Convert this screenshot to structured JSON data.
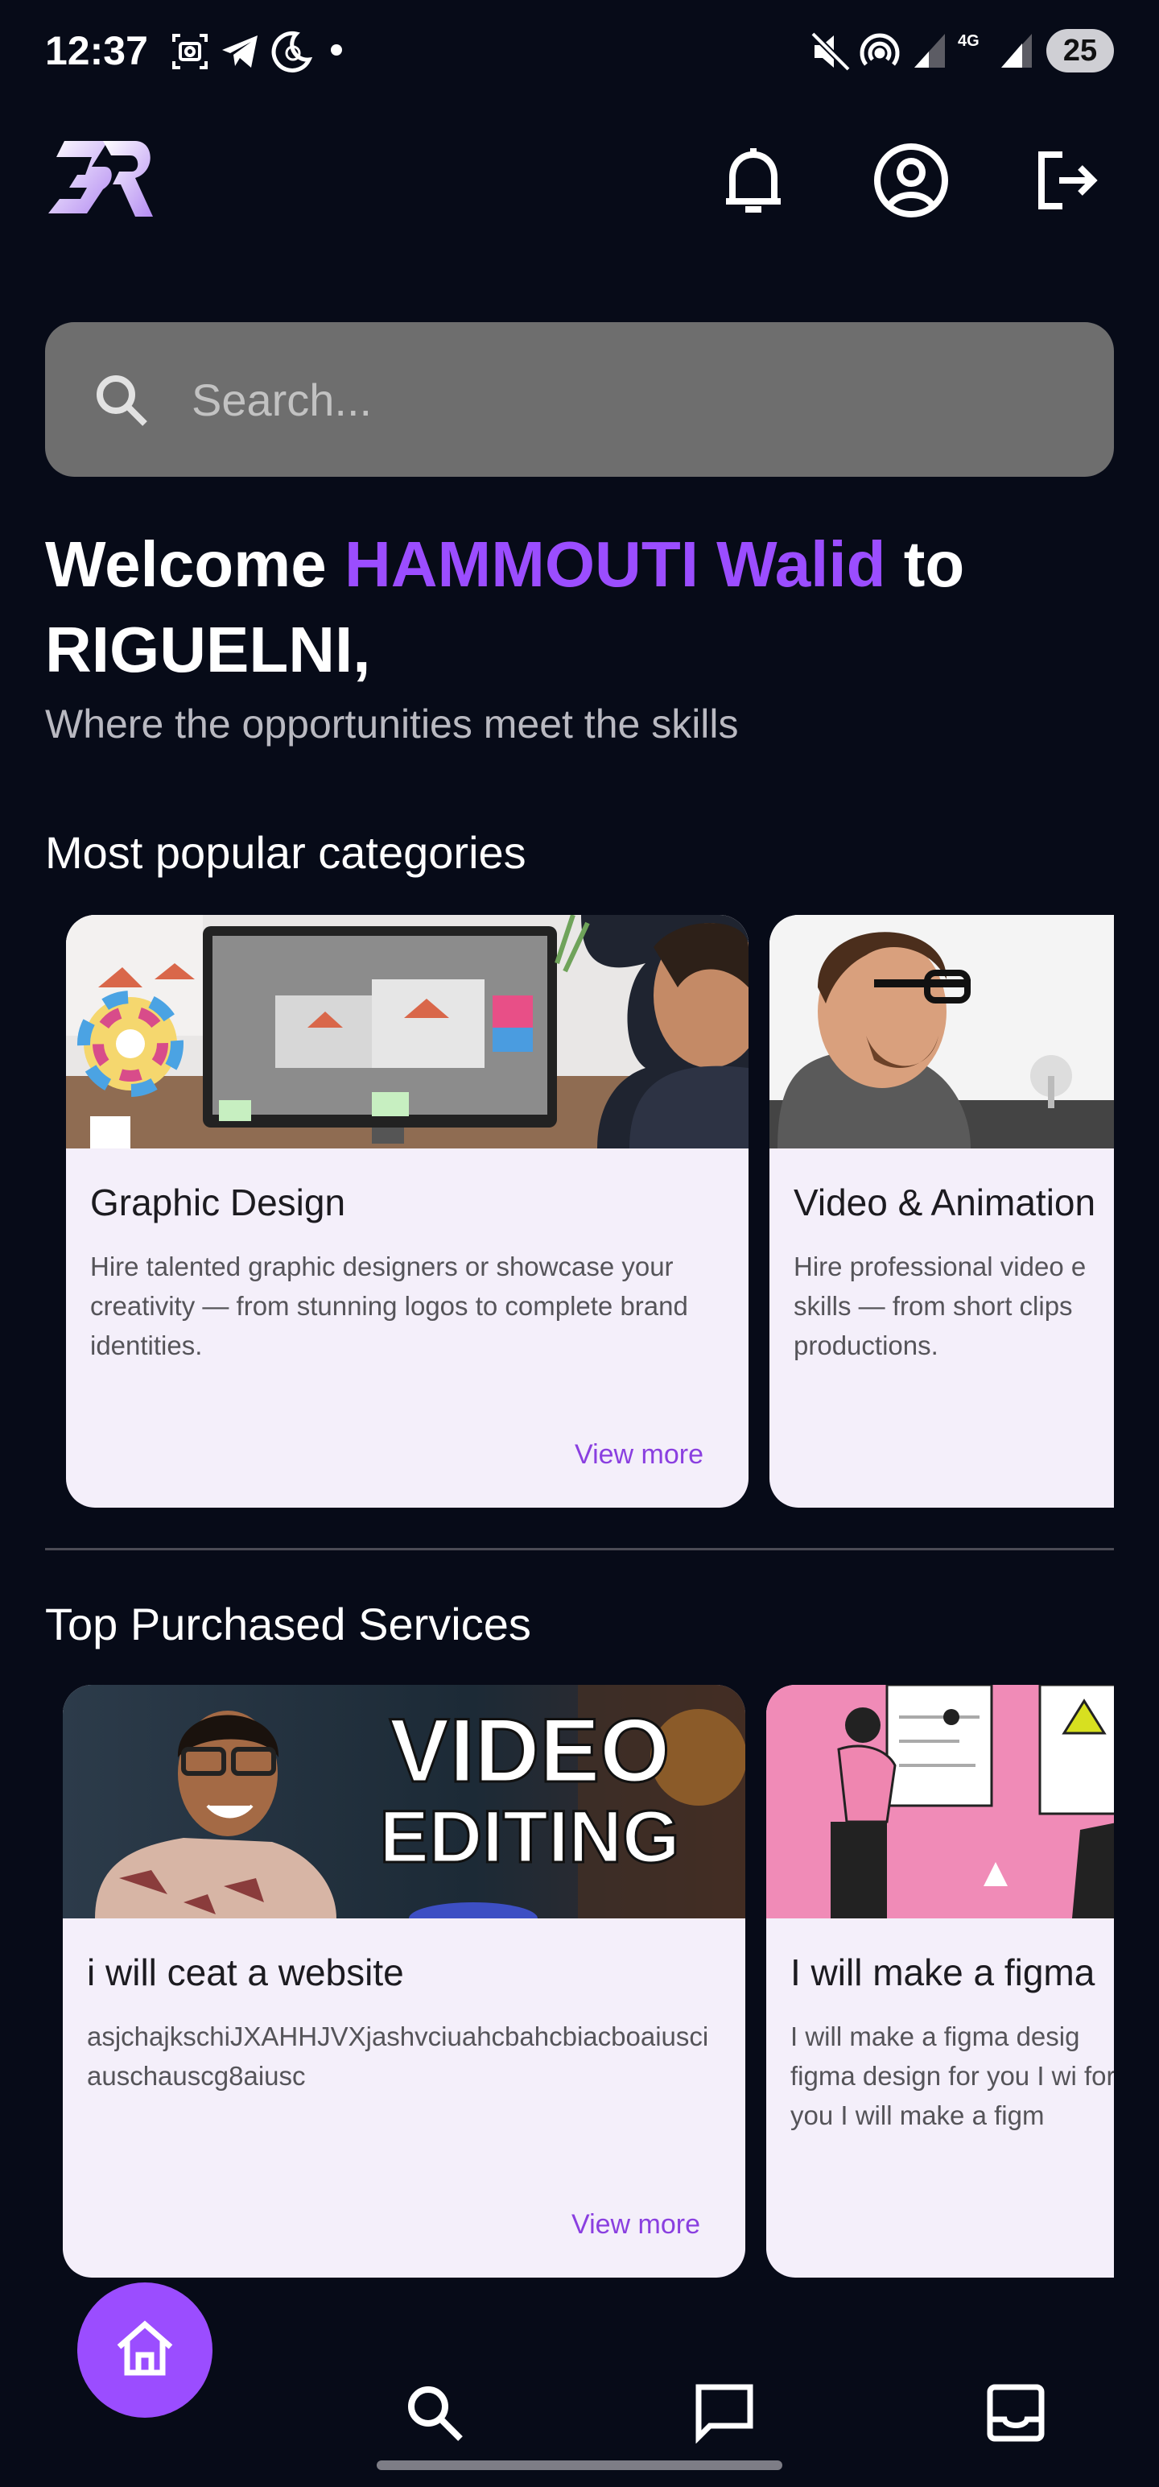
{
  "status_bar": {
    "time": "12:37",
    "battery": "25",
    "network": "4G"
  },
  "search": {
    "placeholder": "Search..."
  },
  "welcome": {
    "prefix": "Welcome ",
    "name": "HAMMOUTI Walid",
    "suffix": " to RIGUELNI,",
    "tagline": "Where the opportunities meet the skills"
  },
  "categories": {
    "title": "Most popular categories",
    "items": [
      {
        "title": "Graphic Design",
        "description": "Hire talented graphic designers or showcase your creativity — from stunning logos to complete brand identities.",
        "link": "View more"
      },
      {
        "title": "Video & Animation",
        "description": "Hire professional video e skills — from short clips productions.",
        "link": ""
      }
    ]
  },
  "services": {
    "title": "Top Purchased Services",
    "items": [
      {
        "title": "i will ceat a website",
        "description": "asjchajkschiJXAHHJVXjashvciuahcbahcbiacboaiusciauschauscg8aiusc",
        "image_text_line1": "VIDEO",
        "image_text_line2": "EDITING",
        "link": "View more"
      },
      {
        "title": "I will make a figma",
        "description": "I will make a figma desig figma design for you I wi for you I will make a figm",
        "link": ""
      }
    ]
  },
  "colors": {
    "background": "#070b18",
    "accent": "#9b4dff",
    "card": "#f4effa",
    "search": "#6e6e6e"
  },
  "icons": {
    "status": [
      "photo-icon",
      "telegram-icon",
      "moon-icon",
      "dot-icon",
      "mute-icon",
      "hotspot-icon",
      "signal-icon",
      "signal-icon",
      "battery-icon"
    ],
    "header": [
      "logo",
      "bell-icon",
      "account-icon",
      "logout-icon"
    ],
    "nav": [
      "home-icon",
      "search-icon",
      "chat-icon",
      "inbox-icon"
    ]
  }
}
